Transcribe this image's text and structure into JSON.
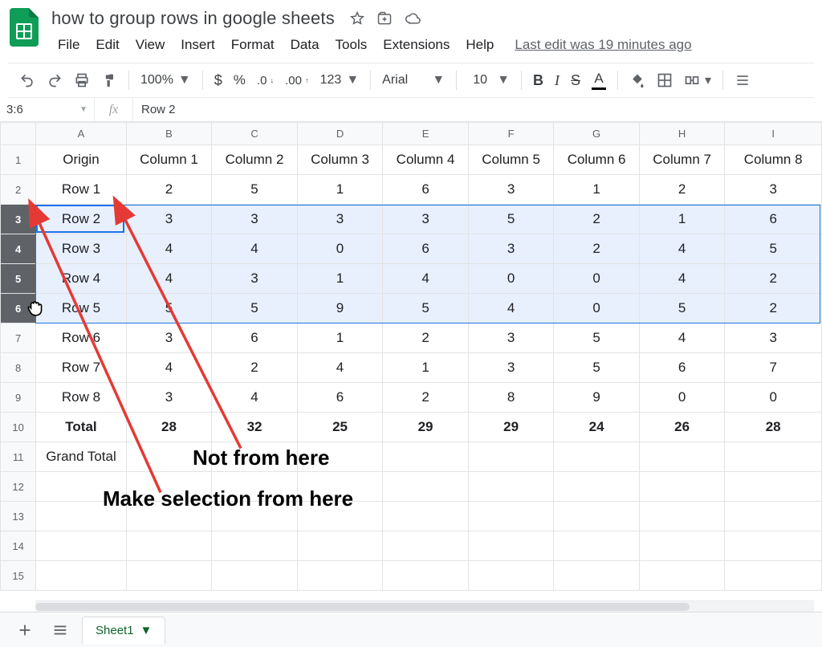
{
  "doc": {
    "title": "how to group rows in google sheets",
    "last_edit": "Last edit was 19 minutes ago"
  },
  "menubar": [
    "File",
    "Edit",
    "View",
    "Insert",
    "Format",
    "Data",
    "Tools",
    "Extensions",
    "Help"
  ],
  "toolbar": {
    "zoom": "100%",
    "font": "Arial",
    "fontsize": "10"
  },
  "namebox": "3:6",
  "formula": "Row 2",
  "columns": [
    "A",
    "B",
    "C",
    "D",
    "E",
    "F",
    "G",
    "H",
    "I"
  ],
  "header_row_labels": [
    "Origin",
    "Column 1",
    "Column 2",
    "Column 3",
    "Column 4",
    "Column 5",
    "Column 6",
    "Column 7",
    "Column 8"
  ],
  "rows": [
    {
      "n": "1",
      "cells": [
        "Origin",
        "Column 1",
        "Column 2",
        "Column 3",
        "Column 4",
        "Column 5",
        "Column 6",
        "Column 7",
        "Column 8"
      ]
    },
    {
      "n": "2",
      "cells": [
        "Row 1",
        "2",
        "5",
        "1",
        "6",
        "3",
        "1",
        "2",
        "3"
      ]
    },
    {
      "n": "3",
      "cells": [
        "Row 2",
        "3",
        "3",
        "3",
        "3",
        "5",
        "2",
        "1",
        "6"
      ],
      "selected": true,
      "active": true
    },
    {
      "n": "4",
      "cells": [
        "Row 3",
        "4",
        "4",
        "0",
        "6",
        "3",
        "2",
        "4",
        "5"
      ],
      "selected": true
    },
    {
      "n": "5",
      "cells": [
        "Row 4",
        "4",
        "3",
        "1",
        "4",
        "0",
        "0",
        "4",
        "2"
      ],
      "selected": true
    },
    {
      "n": "6",
      "cells": [
        "Row 5",
        "5",
        "5",
        "9",
        "5",
        "4",
        "0",
        "5",
        "2"
      ],
      "selected": true
    },
    {
      "n": "7",
      "cells": [
        "Row 6",
        "3",
        "6",
        "1",
        "2",
        "3",
        "5",
        "4",
        "3"
      ]
    },
    {
      "n": "8",
      "cells": [
        "Row 7",
        "4",
        "2",
        "4",
        "1",
        "3",
        "5",
        "6",
        "7"
      ]
    },
    {
      "n": "9",
      "cells": [
        "Row 8",
        "3",
        "4",
        "6",
        "2",
        "8",
        "9",
        "0",
        "0"
      ]
    },
    {
      "n": "10",
      "cells": [
        "Total",
        "28",
        "32",
        "25",
        "29",
        "29",
        "24",
        "26",
        "28"
      ],
      "total": true
    },
    {
      "n": "11",
      "cells": [
        "Grand Total",
        "",
        "",
        "",
        "",
        "",
        "",
        "",
        ""
      ]
    },
    {
      "n": "12",
      "cells": [
        "",
        "",
        "",
        "",
        "",
        "",
        "",
        "",
        ""
      ]
    },
    {
      "n": "13",
      "cells": [
        "",
        "",
        "",
        "",
        "",
        "",
        "",
        "",
        ""
      ]
    },
    {
      "n": "14",
      "cells": [
        "",
        "",
        "",
        "",
        "",
        "",
        "",
        "",
        ""
      ]
    },
    {
      "n": "15",
      "cells": [
        "",
        "",
        "",
        "",
        "",
        "",
        "",
        "",
        ""
      ]
    }
  ],
  "tab": "Sheet1",
  "annotations": {
    "label1": "Not from here",
    "label2": "Make selection from here"
  },
  "chart_data": {
    "type": "table",
    "title": "how to group rows in google sheets",
    "columns": [
      "Origin",
      "Column 1",
      "Column 2",
      "Column 3",
      "Column 4",
      "Column 5",
      "Column 6",
      "Column 7",
      "Column 8"
    ],
    "rows": [
      [
        "Row 1",
        2,
        5,
        1,
        6,
        3,
        1,
        2,
        3
      ],
      [
        "Row 2",
        3,
        3,
        3,
        3,
        5,
        2,
        1,
        6
      ],
      [
        "Row 3",
        4,
        4,
        0,
        6,
        3,
        2,
        4,
        5
      ],
      [
        "Row 4",
        4,
        3,
        1,
        4,
        0,
        0,
        4,
        2
      ],
      [
        "Row 5",
        5,
        5,
        9,
        5,
        4,
        0,
        5,
        2
      ],
      [
        "Row 6",
        3,
        6,
        1,
        2,
        3,
        5,
        4,
        3
      ],
      [
        "Row 7",
        4,
        2,
        4,
        1,
        3,
        5,
        6,
        7
      ],
      [
        "Row 8",
        3,
        4,
        6,
        2,
        8,
        9,
        0,
        0
      ],
      [
        "Total",
        28,
        32,
        25,
        29,
        29,
        24,
        26,
        28
      ],
      [
        "Grand Total",
        null,
        null,
        null,
        null,
        null,
        null,
        null,
        null
      ]
    ],
    "selected_rows": [
      "Row 2",
      "Row 3",
      "Row 4",
      "Row 5"
    ]
  }
}
